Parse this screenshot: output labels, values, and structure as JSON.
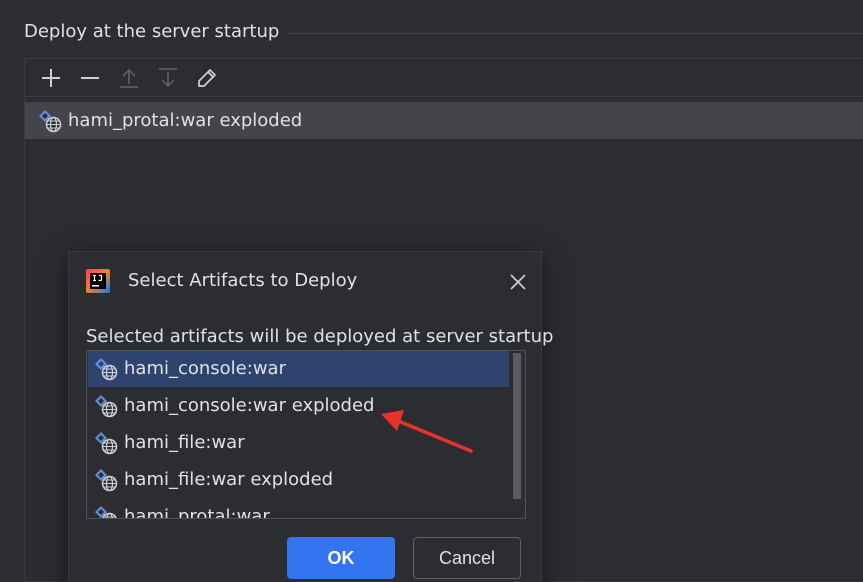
{
  "section": {
    "title": "Deploy at the server startup"
  },
  "toolbar": {
    "buttons": [
      {
        "icon": "plus-icon",
        "enabled": true
      },
      {
        "icon": "minus-icon",
        "enabled": true
      },
      {
        "icon": "move-up-icon",
        "enabled": false
      },
      {
        "icon": "move-down-icon",
        "enabled": false
      },
      {
        "icon": "edit-icon",
        "enabled": true
      }
    ]
  },
  "deploy_list": {
    "items": [
      {
        "label": "hami_protal:war exploded",
        "icon": "artifact-web-icon"
      }
    ]
  },
  "dialog": {
    "title": "Select Artifacts to Deploy",
    "description": "Selected artifacts will be deployed at server startup",
    "artifacts": [
      {
        "label": "hami_console:war",
        "selected": true
      },
      {
        "label": "hami_console:war exploded",
        "selected": false
      },
      {
        "label": "hami_file:war",
        "selected": false
      },
      {
        "label": "hami_file:war exploded",
        "selected": false
      },
      {
        "label": "hami_protal:war",
        "selected": false
      }
    ],
    "ok_label": "OK",
    "cancel_label": "Cancel"
  },
  "colors": {
    "background": "#2b2d30",
    "selection": "#2e436e",
    "row_highlight": "#43454a",
    "primary_button": "#3574f0",
    "annotation_arrow": "#e8332b"
  }
}
